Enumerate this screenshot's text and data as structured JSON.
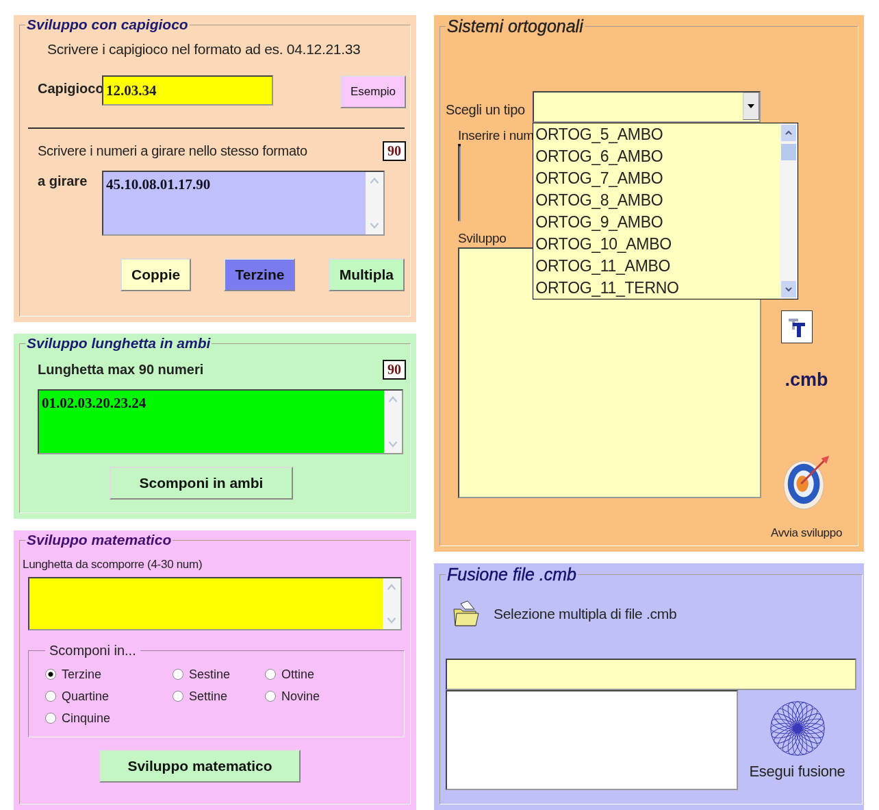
{
  "capigioco_panel": {
    "title": "Sviluppo con capigioco",
    "instruction": "Scrivere i capigioco nel formato ad es. 04.12.21.33",
    "field_label": "Capigioco",
    "field_value": "12.03.34",
    "example_button": "Esempio",
    "numbers_hint": "Scrivere i numeri a girare nello stesso formato",
    "numbers_count": "90",
    "numbers_label": "a girare",
    "numbers_value": "45.10.08.01.17.90",
    "buttons": [
      {
        "label": "Coppie",
        "color": "#ffffc8"
      },
      {
        "label": "Terzine",
        "color": "#7b7bf0"
      },
      {
        "label": "Multipla",
        "color": "#c0f8c0"
      }
    ]
  },
  "lunghetta_panel": {
    "title": "Sviluppo lunghetta in ambi",
    "label": "Lunghetta max 90 numeri",
    "count": "90",
    "value": "01.02.03.20.23.24",
    "button": "Scomponi in ambi"
  },
  "matematico_panel": {
    "title": "Sviluppo matematico",
    "field_label": "Lunghetta da scomporre (4-30 num)",
    "group_title": "Scomponi in...",
    "option_columns": [
      [
        {
          "label": "Terzine",
          "selected": true
        },
        {
          "label": "Quartine",
          "selected": false
        },
        {
          "label": "Cinquine",
          "selected": false
        }
      ],
      [
        {
          "label": "Sestine",
          "selected": false
        },
        {
          "label": "Settine",
          "selected": false
        }
      ],
      [
        {
          "label": "Ottine",
          "selected": false
        },
        {
          "label": "Novine",
          "selected": false
        }
      ]
    ],
    "button": "Sviluppo matematico"
  },
  "ortogonali_panel": {
    "title": "Sistemi ortogonali",
    "type_label": "Scegli un tipo",
    "type_expanded": true,
    "type_options": [
      "ORTOG_5_AMBO",
      "ORTOG_6_AMBO",
      "ORTOG_7_AMBO",
      "ORTOG_8_AMBO",
      "ORTOG_9_AMBO",
      "ORTOG_10_AMBO",
      "ORTOG_11_AMBO",
      "ORTOG_11_TERNO"
    ],
    "numbers_label": "Inserire i num",
    "result_label": "Sviluppo",
    "extension": ".cmb",
    "start_label": "Avvia sviluppo"
  },
  "fusione_panel": {
    "title": "Fusione file .cmb",
    "select_label": "Selezione multipla di file .cmb",
    "merge_label": "Esegui fusione"
  }
}
